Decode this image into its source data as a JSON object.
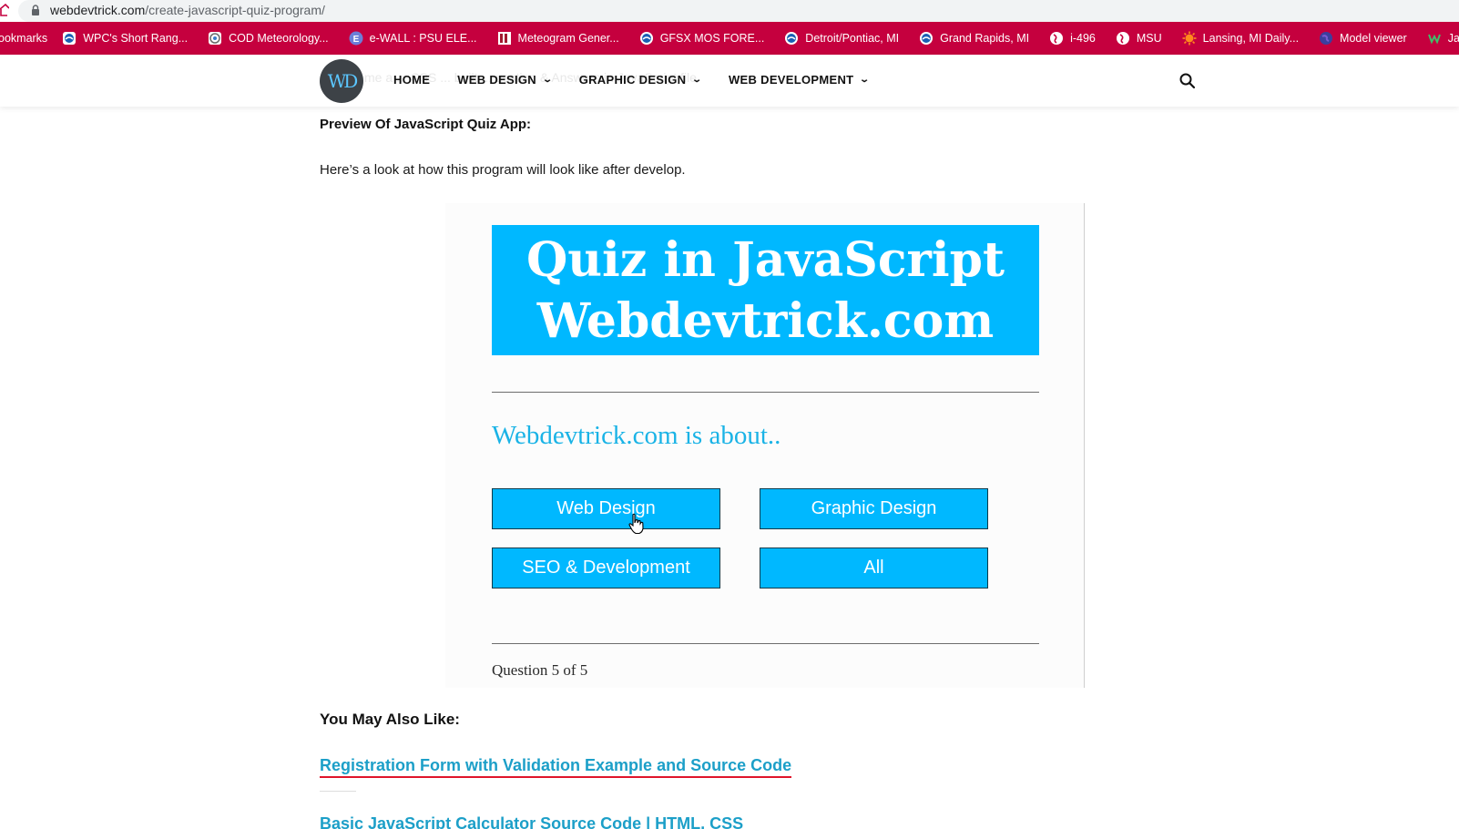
{
  "browser": {
    "url_host": "webdevtrick.com",
    "url_path": "/create-javascript-quiz-program/"
  },
  "bookmarks": [
    {
      "label": "ookmarks",
      "icon": "bookmarks-icon"
    },
    {
      "label": "WPC's Short Rang...",
      "icon": "noaa-icon"
    },
    {
      "label": "COD Meteorology...",
      "icon": "cod-icon"
    },
    {
      "label": "e-WALL : PSU ELE...",
      "icon": "e-icon"
    },
    {
      "label": "Meteogram Gener...",
      "icon": "meteogram-icon"
    },
    {
      "label": "GFSX MOS FORE...",
      "icon": "noaa-icon"
    },
    {
      "label": "Detroit/Pontiac, MI",
      "icon": "noaa-icon"
    },
    {
      "label": "Grand Rapids, MI",
      "icon": "noaa-icon"
    },
    {
      "label": "i-496",
      "icon": "globe-icon"
    },
    {
      "label": "MSU",
      "icon": "globe-icon"
    },
    {
      "label": "Lansing, MI Daily...",
      "icon": "sun-icon"
    },
    {
      "label": "Model viewer",
      "icon": "earth-icon"
    },
    {
      "label": "JavaScri",
      "icon": "w-icon"
    }
  ],
  "header": {
    "logo_text": "WD",
    "ghost_text": "me a          ...  CSS  ...  built  ...  uestion & Answers in JavaScript file.",
    "nav": [
      {
        "label": "HOME",
        "has_dropdown": false
      },
      {
        "label": "WEB DESIGN",
        "has_dropdown": true
      },
      {
        "label": "GRAPHIC DESIGN",
        "has_dropdown": true
      },
      {
        "label": "WEB DEVELOPMENT",
        "has_dropdown": true
      }
    ],
    "search_icon": "search-icon"
  },
  "article": {
    "preview_heading": "Preview Of JavaScript Quiz App:",
    "intro": "Here’s a look at how this program will look like after develop."
  },
  "quiz": {
    "title_line1": "Quiz in JavaScript",
    "title_line2": "Webdevtrick.com",
    "question": "Webdevtrick.com is about..",
    "choices": [
      "Web Design",
      "Graphic Design",
      "SEO & Development",
      "All"
    ],
    "progress": "Question 5 of 5",
    "accent_color": "#00b8ff"
  },
  "related": {
    "heading": "You May Also Like:",
    "links": [
      "Registration Form with Validation Example and Source Code",
      "Basic JavaScript Calculator Source Code | HTML, CSS"
    ]
  },
  "colors": {
    "bookmarks_bar": "#c5003e",
    "link": "#1c9fc8",
    "link_underline": "#e0152b"
  }
}
